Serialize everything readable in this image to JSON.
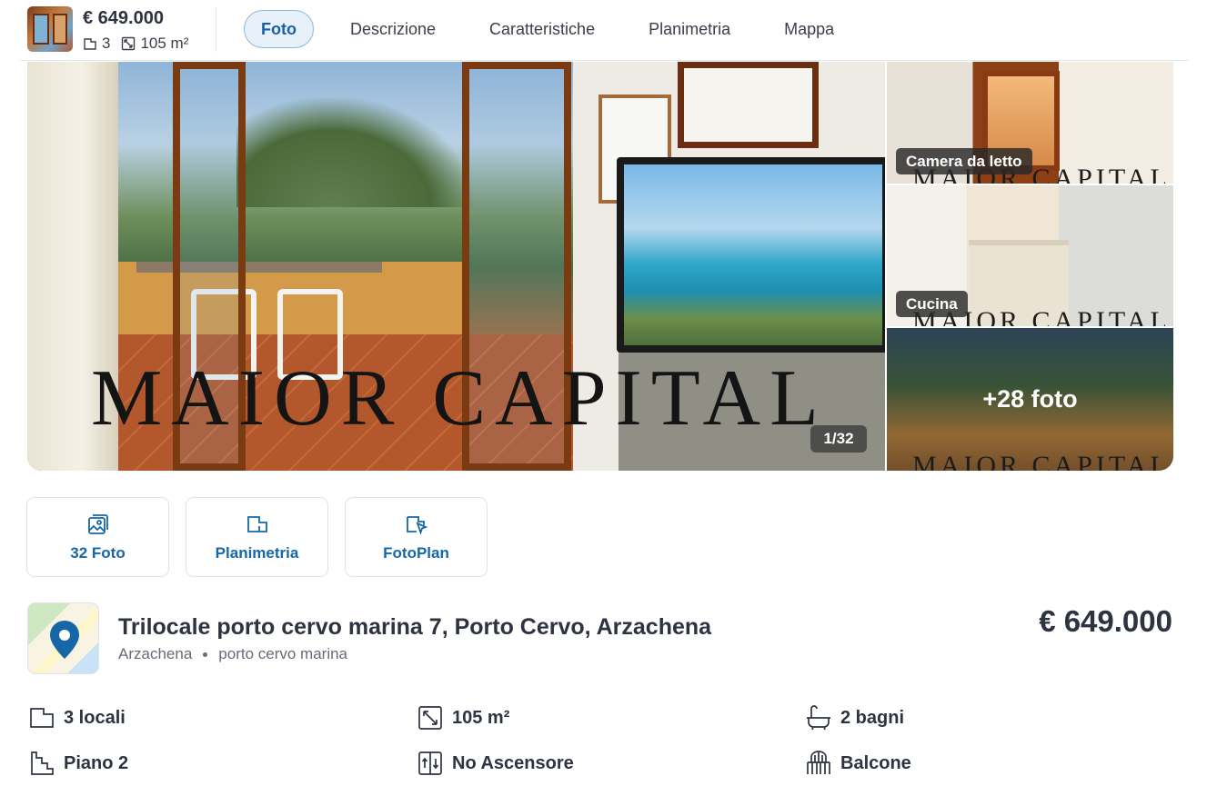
{
  "header": {
    "price": "€ 649.000",
    "rooms": "3",
    "surface": "105 m²",
    "tabs": [
      "Foto",
      "Descrizione",
      "Caratteristiche",
      "Planimetria",
      "Mappa"
    ],
    "active_tab": "Foto"
  },
  "gallery": {
    "watermark": "MAIOR CAPITAL",
    "counter": "1/32",
    "side_photos": [
      {
        "label": "Camera da letto"
      },
      {
        "label": "Cucina"
      },
      {
        "label": "+28 foto"
      }
    ]
  },
  "actions": [
    {
      "label": "32 Foto",
      "icon": "photos-icon"
    },
    {
      "label": "Planimetria",
      "icon": "floorplan-icon"
    },
    {
      "label": "FotoPlan",
      "icon": "fotoplan-icon"
    }
  ],
  "listing": {
    "title": "Trilocale porto cervo marina 7, Porto Cervo, Arzachena",
    "city": "Arzachena",
    "zone": "porto cervo marina",
    "price": "€ 649.000"
  },
  "features": [
    {
      "label": "3 locali",
      "icon": "rooms-icon"
    },
    {
      "label": "105 m²",
      "icon": "surface-icon"
    },
    {
      "label": "2 bagni",
      "icon": "bathtub-icon"
    },
    {
      "label": "Piano 2",
      "icon": "stairs-icon"
    },
    {
      "label": "No Ascensore",
      "icon": "elevator-icon"
    },
    {
      "label": "Balcone",
      "icon": "balcony-icon"
    }
  ],
  "colors": {
    "accent": "#1667a8",
    "tab_active_bg": "#e8f1f9",
    "text": "#2d3340"
  }
}
